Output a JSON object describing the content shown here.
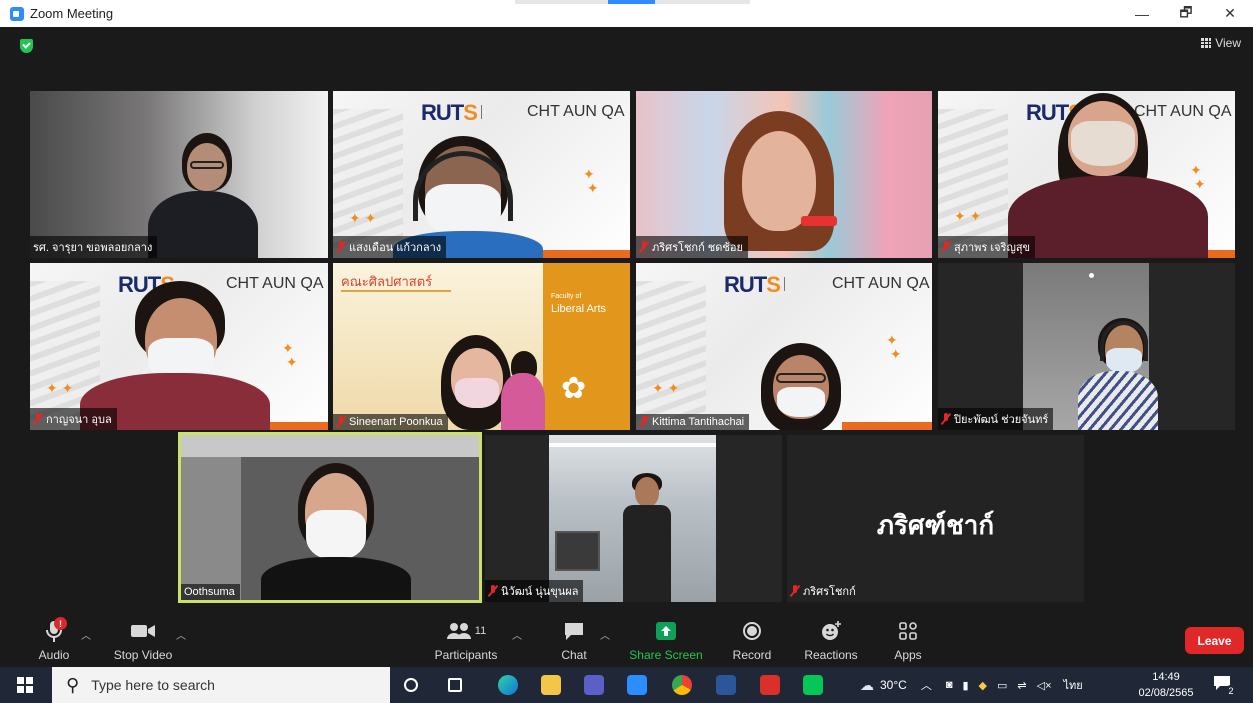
{
  "window": {
    "title": "Zoom Meeting",
    "minimize": "—",
    "restore": "🗗",
    "close": "✕"
  },
  "top": {
    "view_label": "View"
  },
  "tiles": [
    {
      "name": "รศ. จารุยา ขอพลอยกลาง",
      "muted": false
    },
    {
      "name": "แสงเดือน แก้วกลาง",
      "muted": true,
      "bg_title": "CHT AUN QA"
    },
    {
      "name": "ภริศรโชกก์ ชดช้อย",
      "muted": true
    },
    {
      "name": "สุภาพร เจริญสุข",
      "muted": true,
      "bg_title": "CHT AUN QA"
    },
    {
      "name": "กาญจนา อุบล",
      "muted": true,
      "bg_title": "CHT AUN QA"
    },
    {
      "name": "Sineenart Poonkua",
      "muted": true,
      "bg_thai": "คณะศิลปศาสตร์",
      "bg_faculty": "Faculty of",
      "bg_faculty2": "Liberal Arts"
    },
    {
      "name": "Kittima Tantihachai",
      "muted": true,
      "bg_title": "CHT AUN QA"
    },
    {
      "name": "ปิยะพัฒน์ ช่วยจันทร์",
      "muted": true
    },
    {
      "name": "Oothsuma",
      "muted": false
    },
    {
      "name": "นิวัฒน์ นุ่นขุนผล",
      "muted": true
    },
    {
      "name": "ภริศรโชกก์",
      "muted": true,
      "big_name": "ภริศฑ์ชาก์"
    }
  ],
  "logo_text": {
    "main": "RUT",
    "accent": "S"
  },
  "controls": {
    "audio": "Audio",
    "stop_video": "Stop Video",
    "participants": "Participants",
    "participants_count": "11",
    "chat": "Chat",
    "share_screen": "Share Screen",
    "record": "Record",
    "reactions": "Reactions",
    "apps": "Apps",
    "leave": "Leave",
    "audio_badge": "!"
  },
  "taskbar": {
    "search_placeholder": "Type here to search",
    "weather": "30°C",
    "lang": "ไทย",
    "time": "14:49",
    "date": "02/08/2565",
    "notif_count": "2"
  },
  "colors": {
    "accent_green": "#23c552",
    "leave_red": "#e02828",
    "share_green": "#0e9f59",
    "active_border": "#c9e267"
  }
}
